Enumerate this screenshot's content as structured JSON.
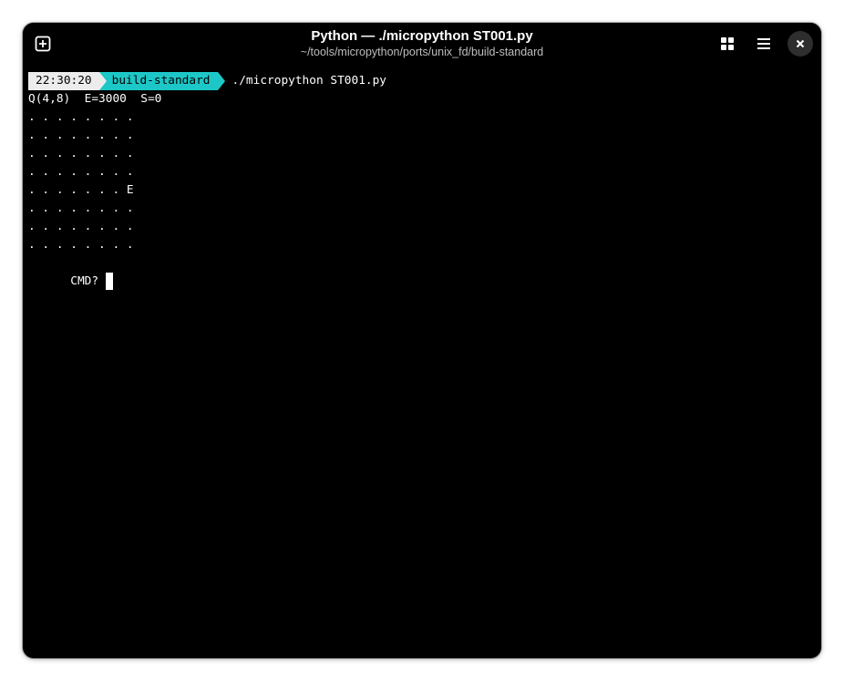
{
  "window": {
    "title": "Python — ./micropython ST001.py",
    "subtitle": "~/tools/micropython/ports/unix_fd/build-standard"
  },
  "header_buttons": {
    "new_tab_icon": "new-tab-icon",
    "tabs_overview_icon": "grid-icon",
    "menu_icon": "hamburger-menu-icon",
    "close_icon": "close-icon"
  },
  "prompt": {
    "time": "22:30:20",
    "directory": "build-standard",
    "command": "./micropython ST001.py"
  },
  "output": {
    "status_line": "Q(4,8)  E=3000  S=0",
    "grid_rows": [
      ". . . . . . . .",
      ". . . . . . . .",
      ". . . . . . . .",
      ". . . . . . . .",
      ". . . . . . . E",
      ". . . . . . . .",
      ". . . . . . . .",
      ". . . . . . . ."
    ],
    "input_prompt": "CMD? "
  },
  "colors": {
    "terminal_bg": "#000000",
    "terminal_fg": "#ffffff",
    "time_segment_bg": "#ececec",
    "dir_segment_bg": "#1ec7c7"
  }
}
